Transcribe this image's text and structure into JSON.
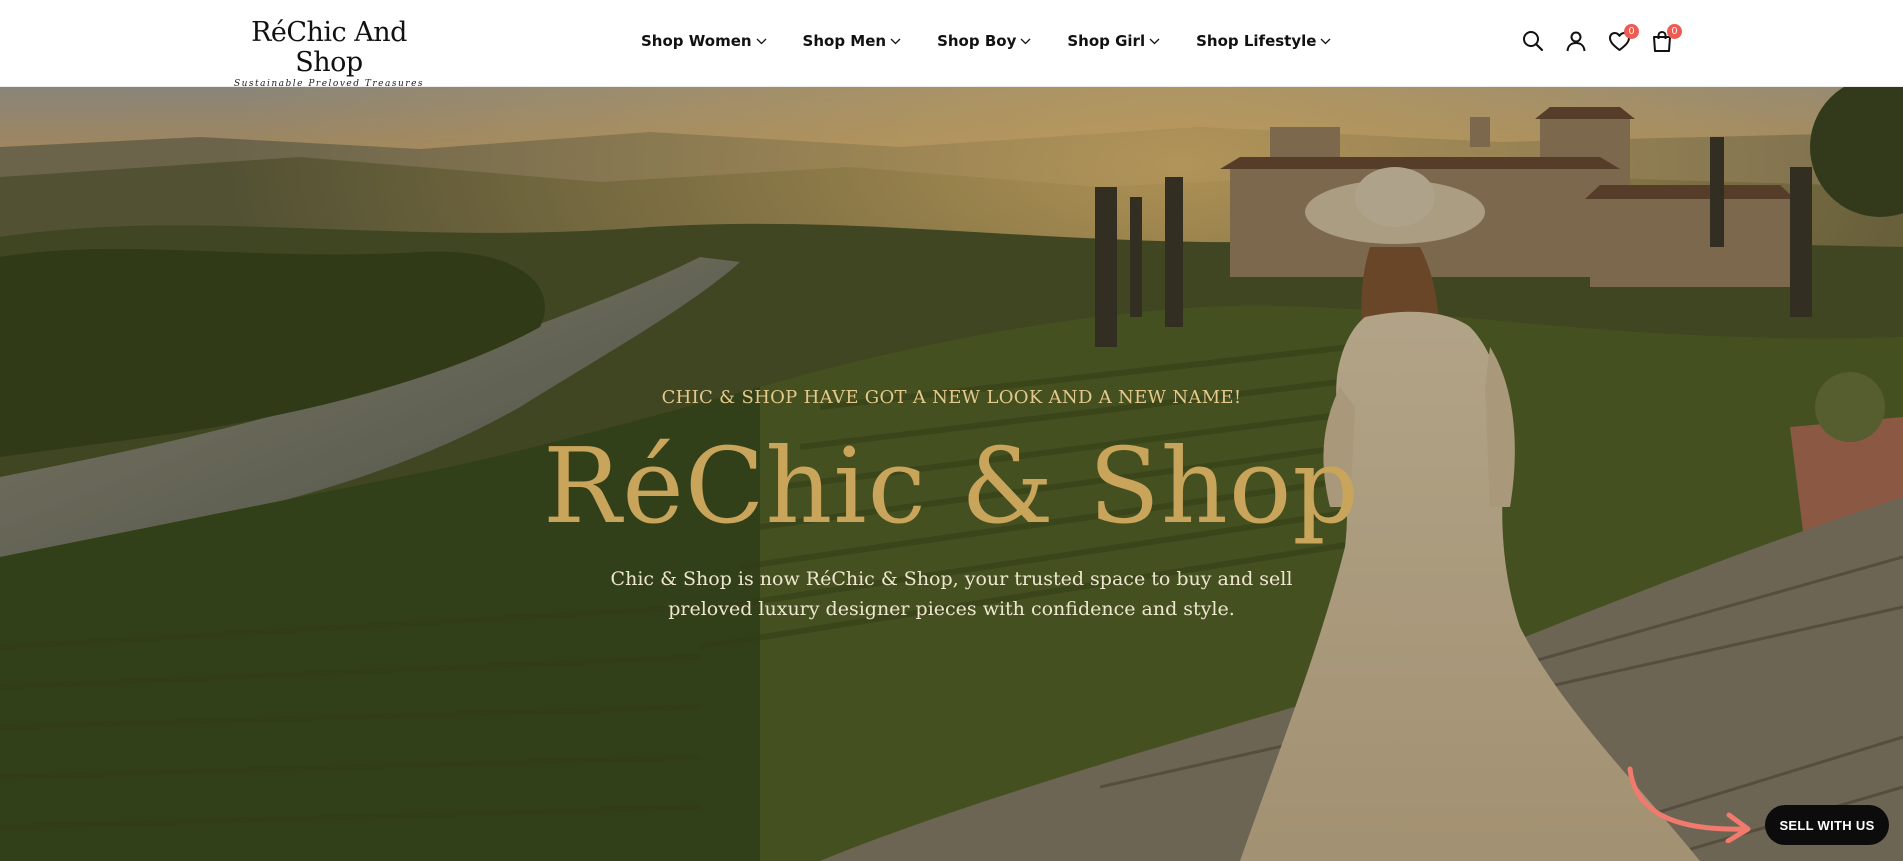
{
  "header": {
    "logo": {
      "title": "RéChic And Shop",
      "tagline": "Sustainable Preloved Treasures"
    },
    "nav": [
      {
        "label": "Shop Women",
        "icon": "chevron-down-icon"
      },
      {
        "label": "Shop Men",
        "icon": "chevron-down-icon"
      },
      {
        "label": "Shop Boy",
        "icon": "chevron-down-icon"
      },
      {
        "label": "Shop Girl",
        "icon": "chevron-down-icon"
      },
      {
        "label": "Shop Lifestyle",
        "icon": "chevron-down-icon"
      }
    ],
    "icons": {
      "search": "search-icon",
      "account": "user-icon",
      "wishlist": "heart-icon",
      "wishlist_count": "0",
      "cart": "bag-icon",
      "cart_count": "0",
      "badge_color": "#ef5a53"
    }
  },
  "hero": {
    "kicker": "CHIC & SHOP HAVE GOT A NEW LOOK AND A NEW NAME!",
    "title": "RéChic & Shop",
    "description": "Chic & Shop is now RéChic & Shop, your trusted space to buy and sell preloved luxury designer pieces with confidence and style.",
    "title_color": "#c9a55c",
    "kicker_color": "#e5c98a"
  },
  "floating": {
    "sell_button": "SELL WITH US",
    "arrow_color": "#f07a6e"
  }
}
